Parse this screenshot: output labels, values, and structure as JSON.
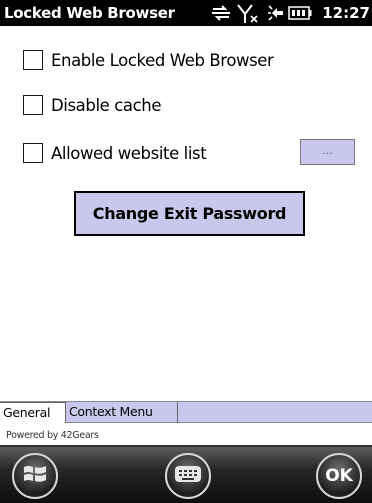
{
  "titlebar": {
    "title": "Locked Web Browser",
    "time": "12:27",
    "icons": [
      "data-sync-icon",
      "no-signal-icon",
      "volume-icon",
      "battery-icon"
    ]
  },
  "options": {
    "enable_locked_browser": {
      "label": "Enable Locked Web Browser",
      "checked": false
    },
    "disable_cache": {
      "label": "Disable cache",
      "checked": false
    },
    "allowed_website_list": {
      "label": "Allowed website list",
      "checked": false
    }
  },
  "browse_button_label": "...",
  "change_password_label": "Change Exit Password",
  "tabs": [
    {
      "label": "General",
      "active": true
    },
    {
      "label": "Context Menu",
      "active": false
    }
  ],
  "footer": {
    "powered_by": "Powered by 42Gears"
  },
  "softkeys": {
    "ok_label": "OK"
  },
  "colors": {
    "button_bg": "#c9c8ec",
    "titlebar_bg": "#000000",
    "softbar_bg": "#1a1a1a"
  }
}
